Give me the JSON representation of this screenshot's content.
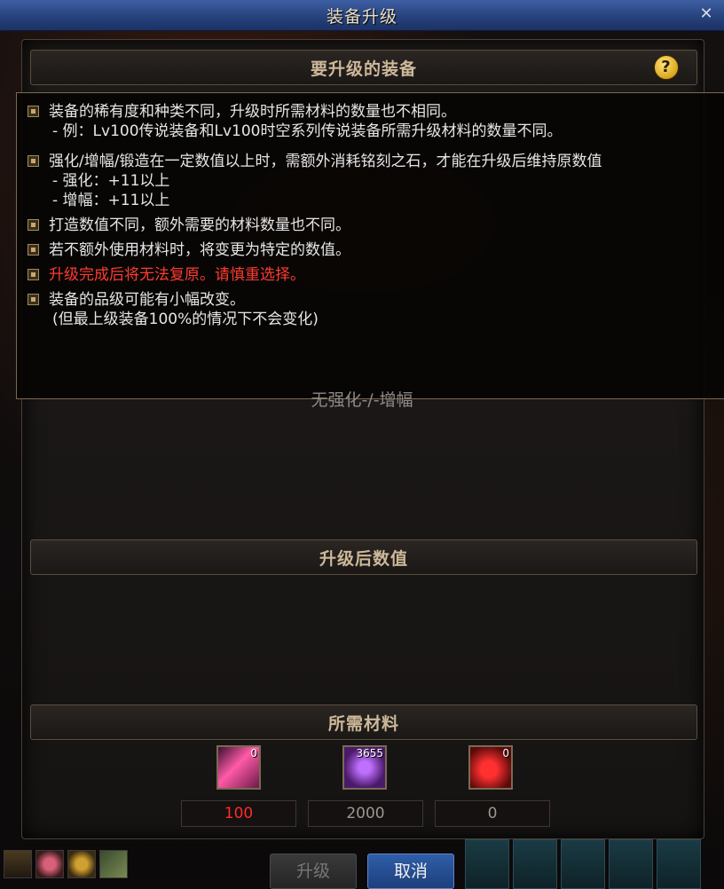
{
  "window": {
    "title": "装备升级",
    "close_icon": "close-icon"
  },
  "sections": {
    "equip_head": "要升级的装备",
    "after_head": "升级后数值",
    "materials_head": "所需材料"
  },
  "help_label": "?",
  "no_enhance_text": "无强化-/-增幅",
  "tooltip": {
    "items": [
      {
        "text": "装备的稀有度和种类不同，升级时所需材料的数量也不相同。",
        "sub": [
          "- 例：Lv100传说装备和Lv100时空系列传说装备所需升级材料的数量不同。"
        ]
      },
      {
        "text": "强化/增幅/锻造在一定数值以上时，需额外消耗铭刻之石，才能在升级后维持原数值",
        "sub": [
          "- 强化：+11以上",
          "- 增幅：+11以上"
        ]
      },
      {
        "text": "打造数值不同，额外需要的材料数量也不同。",
        "sub": []
      },
      {
        "text": "若不额外使用材料时，将变更为特定的数值。",
        "sub": []
      },
      {
        "text": "升级完成后将无法复原。请慎重选择。",
        "sub": [],
        "red": true
      },
      {
        "text": "装备的品级可能有小幅改变。",
        "sub": [
          "(但最上级装备100%的情况下不会变化)"
        ]
      }
    ]
  },
  "materials": [
    {
      "icon": "pink-crystal-icon",
      "count": "0",
      "value": "100",
      "color": "#ff2a2a"
    },
    {
      "icon": "purple-stone-icon",
      "count": "3655",
      "value": "2000",
      "color": "#9b9790"
    },
    {
      "icon": "red-orb-icon",
      "count": "0",
      "value": "0",
      "color": "#9b9790"
    }
  ],
  "buttons": {
    "upgrade": "升级",
    "cancel": "取消"
  }
}
